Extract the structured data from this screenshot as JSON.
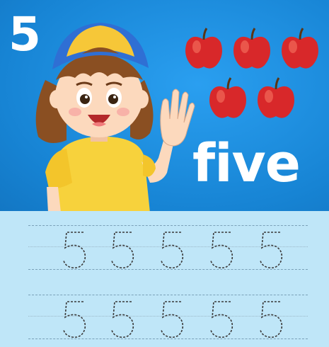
{
  "worksheet": {
    "number": "5",
    "word": "five",
    "apple_count": 5,
    "colors": {
      "background": "#1784d4",
      "tracing_area": "#bfe6f8",
      "apple": "#d8282a",
      "text": "#ffffff"
    },
    "trace_rows": [
      {
        "glyphs": [
          "5",
          "5",
          "5",
          "5",
          "5"
        ]
      },
      {
        "glyphs": [
          "5",
          "5",
          "5",
          "5",
          "5"
        ]
      }
    ],
    "illustration": "girl-waving-icon"
  }
}
